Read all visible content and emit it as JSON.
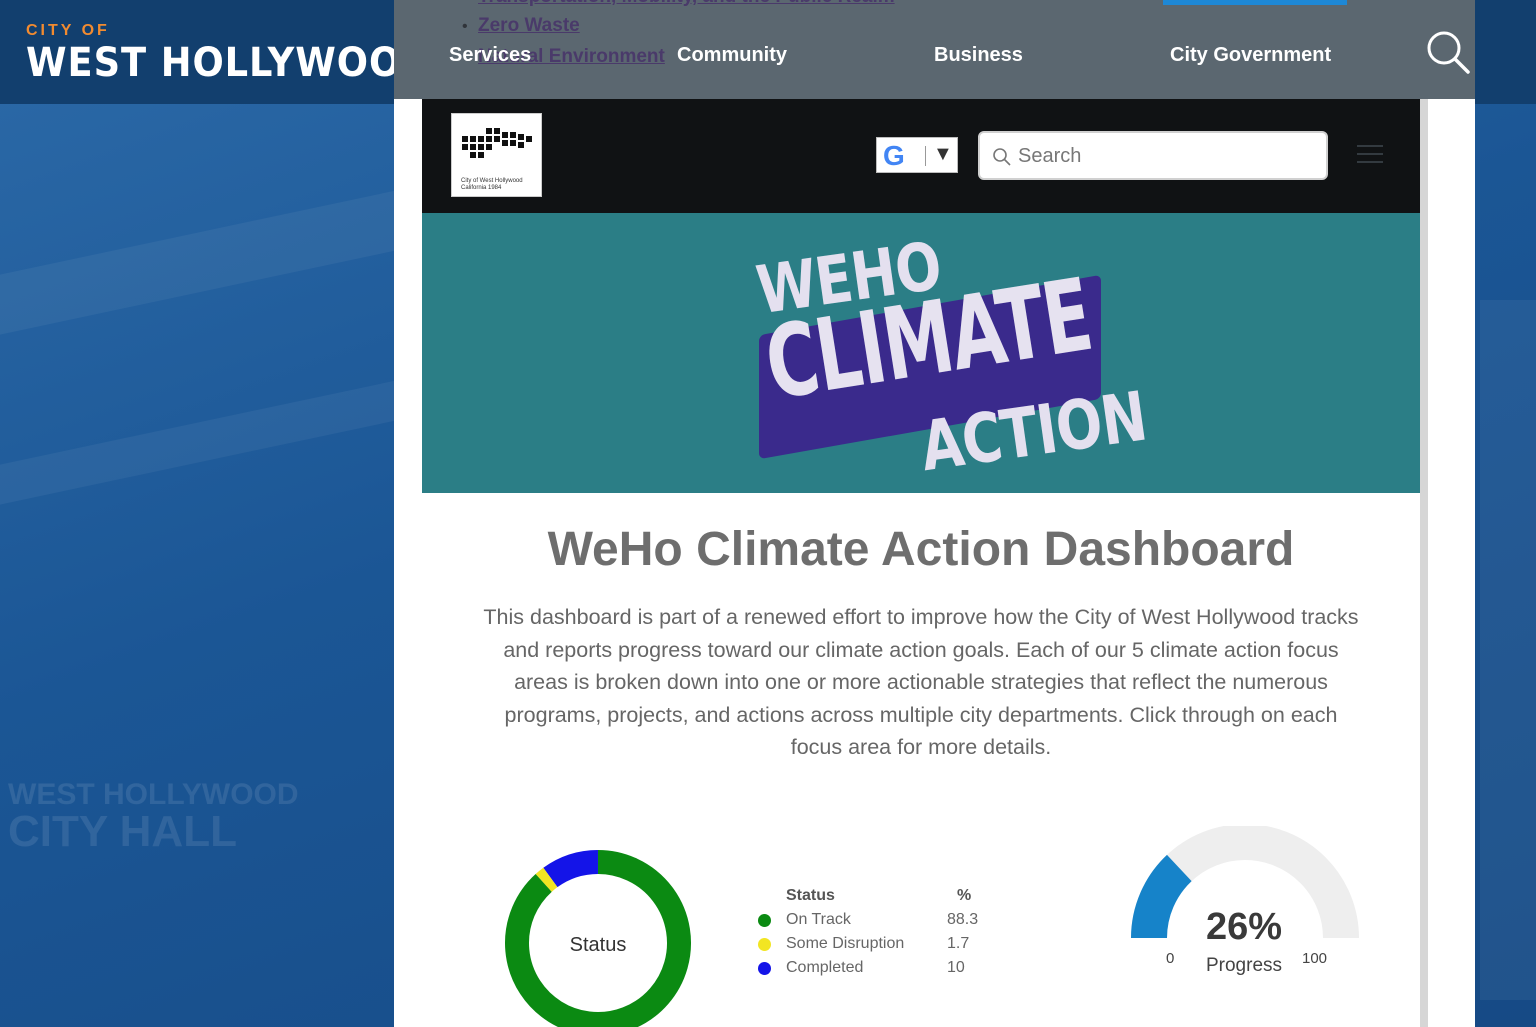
{
  "site": {
    "logo_small": "CITY OF",
    "logo_big": "WEST HOLLYWOOD",
    "nav": [
      "Services",
      "Community",
      "Business",
      "City Government"
    ],
    "bleed_links": [
      "Transportation, Mobility, and the Public Realm",
      "Zero Waste",
      "Natural Environment"
    ],
    "background_text": [
      "WEST HOLLYWOOD",
      "CITY HALL"
    ]
  },
  "dashboard_header": {
    "city_mark_caption": [
      "City of West Hollywood",
      "California 1984"
    ],
    "translate_icon": "google-g",
    "search_placeholder": "Search"
  },
  "banner": {
    "line1": "WEHO",
    "line2": "CLIMATE",
    "line3": "ACTION"
  },
  "main": {
    "title": "WeHo Climate Action Dashboard",
    "intro": "This dashboard is part of a renewed effort to improve how the City of West Hollywood tracks and reports progress toward our climate action goals. Each of our 5 climate action focus areas is broken down into one or more actionable strategies that reflect the numerous programs, projects, and actions across multiple city departments. Click through on each focus area for more details."
  },
  "chart_data": [
    {
      "type": "pie",
      "title": "Status",
      "legend_headers": [
        "Status",
        "%"
      ],
      "categories": [
        "On Track",
        "Some Disruption",
        "Completed"
      ],
      "values": [
        88.3,
        1.7,
        10
      ],
      "value_labels": [
        "88.3",
        "1.7",
        "10"
      ],
      "colors": [
        "#0b8a12",
        "#f2e522",
        "#1414e8"
      ]
    },
    {
      "type": "gauge",
      "value": 26,
      "label": "26%",
      "caption": "Progress",
      "min": 0,
      "max": 100,
      "min_label": "0",
      "max_label": "100",
      "colors": {
        "fill": "#1683c9",
        "track": "#eeeeee"
      }
    }
  ]
}
